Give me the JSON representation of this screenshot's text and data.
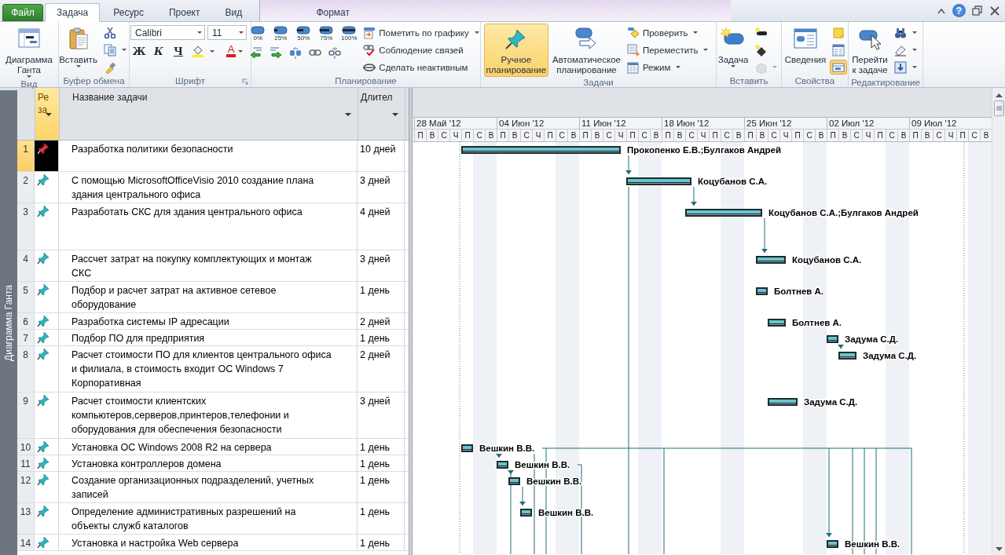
{
  "ribbon": {
    "tabs": [
      {
        "label": "Файл",
        "kind": "file",
        "selected": false
      },
      {
        "label": "Задача",
        "kind": "tab",
        "selected": true
      },
      {
        "label": "Ресурс",
        "kind": "tab",
        "selected": false
      },
      {
        "label": "Проект",
        "kind": "tab",
        "selected": false
      },
      {
        "label": "Вид",
        "kind": "tab",
        "selected": false
      },
      {
        "label": "Формат",
        "kind": "contextual",
        "selected": false
      }
    ],
    "help": "?",
    "groups": [
      {
        "label": "Вид",
        "items": [
          {
            "kind": "large",
            "label_lines": [
              "Диаграмма",
              "Ганта"
            ],
            "dropdown": true
          }
        ]
      },
      {
        "label": "Буфер обмена",
        "items": [
          {
            "kind": "large",
            "label_lines": [
              "Вставить"
            ],
            "dropdown": true
          },
          {
            "kind": "column",
            "items": [
              {
                "kind": "small",
                "dropdown": false
              },
              {
                "kind": "small",
                "dropdown": true
              },
              {
                "kind": "small",
                "dropdown": false
              }
            ]
          }
        ]
      },
      {
        "label": "Шрифт",
        "launcher": true,
        "items": [
          {
            "kind": "column",
            "items": [
              {
                "kind": "row",
                "items": [
                  {
                    "kind": "field",
                    "value": "Calibri"
                  },
                  {
                    "kind": "field",
                    "value": "11"
                  }
                ]
              },
              {
                "kind": "row",
                "items": [
                  {
                    "kind": "bold",
                    "label": "Ж"
                  },
                  {
                    "kind": "italic",
                    "label": "К"
                  },
                  {
                    "kind": "underline",
                    "label": "Ч"
                  },
                  {
                    "kind": "small",
                    "dropdown": true
                  },
                  {
                    "kind": "font-color",
                    "label": "А",
                    "color": "#d42020"
                  }
                ]
              }
            ]
          }
        ]
      },
      {
        "label": "Планирование",
        "items": [
          {
            "kind": "column",
            "items": [
              {
                "kind": "row",
                "items": [
                  {
                    "kind": "percent",
                    "label": "0%"
                  },
                  {
                    "kind": "percent",
                    "label": "25%"
                  },
                  {
                    "kind": "percent",
                    "label": "50%"
                  },
                  {
                    "kind": "percent",
                    "label": "75%"
                  },
                  {
                    "kind": "percent",
                    "label": "100%"
                  }
                ]
              },
              {
                "kind": "row",
                "items": [
                  {
                    "kind": "small",
                    "dropdown": false
                  },
                  {
                    "kind": "small",
                    "dropdown": false
                  },
                  {
                    "kind": "small",
                    "dropdown": false
                  },
                  {
                    "kind": "small",
                    "dropdown": false
                  },
                  {
                    "kind": "small",
                    "dropdown": false
                  }
                ]
              }
            ]
          },
          {
            "kind": "column",
            "items": [
              {
                "kind": "small",
                "label": "Пометить по графику",
                "dropdown": true
              },
              {
                "kind": "small",
                "label": "Соблюдение связей",
                "dropdown": false
              },
              {
                "kind": "small",
                "label": "Сделать неактивным",
                "dropdown": false
              }
            ]
          }
        ]
      },
      {
        "label": "Задачи",
        "items": [
          {
            "kind": "large",
            "label_lines": [
              "Ручное",
              "планирование"
            ],
            "dropdown": false,
            "selected": true
          },
          {
            "kind": "large",
            "label_lines": [
              "Автоматическое",
              "планирование"
            ],
            "dropdown": false,
            "selected": false
          },
          {
            "kind": "column",
            "items": [
              {
                "kind": "small",
                "label": "Проверить",
                "dropdown": true
              },
              {
                "kind": "small",
                "label": "Переместить",
                "dropdown": true
              },
              {
                "kind": "small",
                "label": "Режим",
                "dropdown": true
              }
            ]
          }
        ]
      },
      {
        "label": "Вставить",
        "items": [
          {
            "kind": "large",
            "label_lines": [
              "Задача"
            ],
            "dropdown": true
          },
          {
            "kind": "column",
            "items": [
              {
                "kind": "small",
                "dropdown": false,
                "disabled": false
              },
              {
                "kind": "small",
                "dropdown": false,
                "disabled": false
              },
              {
                "kind": "small",
                "dropdown": true,
                "disabled": true
              }
            ]
          }
        ]
      },
      {
        "label": "Свойства",
        "items": [
          {
            "kind": "large",
            "label_lines": [
              "Сведения"
            ],
            "dropdown": false
          },
          {
            "kind": "column",
            "items": [
              {
                "kind": "small",
                "dropdown": false,
                "on": false
              },
              {
                "kind": "small",
                "dropdown": false,
                "on": false
              },
              {
                "kind": "small",
                "dropdown": false,
                "on": true
              }
            ]
          }
        ]
      },
      {
        "label": "Редактирование",
        "items": [
          {
            "kind": "large",
            "label_lines": [
              "Перейти",
              "к задаче"
            ],
            "dropdown": false
          },
          {
            "kind": "column",
            "items": [
              {
                "kind": "small",
                "dropdown": true
              },
              {
                "kind": "small",
                "dropdown": true
              },
              {
                "kind": "small",
                "dropdown": true
              }
            ]
          }
        ]
      }
    ]
  },
  "view_bar": {
    "label": "Диаграмма Ганта"
  },
  "table": {
    "columns": [
      {
        "kind": "indicator",
        "label_lines": [
          "Ре",
          "за"
        ],
        "selected": true
      },
      {
        "kind": "name",
        "label_lines": [
          "Название задачи"
        ],
        "selected": false
      },
      {
        "kind": "duration",
        "label_lines": [
          "Длител"
        ],
        "selected": false
      }
    ],
    "rows": [
      {
        "id": "1",
        "selected": true,
        "name_lines": [
          "Разработка политики безопасности"
        ],
        "duration": "10 дней",
        "resources": "Прокопенко Е.В.;Булгаков Андрей"
      },
      {
        "id": "2",
        "selected": false,
        "name_lines": [
          "С помощью MicrosoftOfficeVisio 2010 создание плана",
          "здания центрального офиса"
        ],
        "duration": "3 дней",
        "resources": "Коцубанов С.А."
      },
      {
        "id": "3",
        "selected": false,
        "name_lines": [
          "Разработать СКС для здания центрального офиса"
        ],
        "duration": "4 дней",
        "resources": "Коцубанов С.А.;Булгаков Андрей"
      },
      {
        "id": "4",
        "selected": false,
        "name_lines": [
          "Рассчет затрат на покупку комплектующих и монтаж",
          "СКС"
        ],
        "duration": "3 дней",
        "resources": "Коцубанов С.А."
      },
      {
        "id": "5",
        "selected": false,
        "name_lines": [
          "Подбор и расчет затрат на активное сетевое",
          "оборудование"
        ],
        "duration": "1 день",
        "resources": "Болтнев А."
      },
      {
        "id": "6",
        "selected": false,
        "name_lines": [
          "Разработка системы IP адресации"
        ],
        "duration": "2 дней",
        "resources": "Болтнев А."
      },
      {
        "id": "7",
        "selected": false,
        "name_lines": [
          "Подбор ПО для предприятия"
        ],
        "duration": "1 день",
        "resources": "Задума С.Д."
      },
      {
        "id": "8",
        "selected": false,
        "name_lines": [
          "Расчет стоимости ПО для клиентов центрального офиса",
          "и филиала, в стоимость входит ОС Windows 7",
          "Корпоративная"
        ],
        "duration": "2 дней",
        "resources": "Задума С.Д."
      },
      {
        "id": "9",
        "selected": false,
        "name_lines": [
          "Расчет стоимости клиентских",
          "компьютеров,серверов,принтеров,телефонии и",
          "оборудования для обеспечения безопасности"
        ],
        "duration": "3 дней",
        "resources": "Задума С.Д."
      },
      {
        "id": "10",
        "selected": false,
        "name_lines": [
          "Установка ОС Windows 2008 R2 на сервера"
        ],
        "duration": "1 день",
        "resources": "Вешкин В.В."
      },
      {
        "id": "11",
        "selected": false,
        "name_lines": [
          "Установка контроллеров домена"
        ],
        "duration": "1 день",
        "resources": "Вешкин В.В."
      },
      {
        "id": "12",
        "selected": false,
        "name_lines": [
          "Создание организационных подразделений, учетных",
          "записей"
        ],
        "duration": "1 день",
        "resources": "Вешкин В.В."
      },
      {
        "id": "13",
        "selected": false,
        "name_lines": [
          "Определение административных разрешений на",
          "объекты служб каталогов"
        ],
        "duration": "1 день",
        "resources": "Вешкин В.В."
      },
      {
        "id": "14",
        "selected": false,
        "name_lines": [
          "Установка и настройка Web сервера"
        ],
        "duration": "1 день",
        "resources": "Вешкин В.В."
      }
    ]
  },
  "gantt": {
    "weeks": [
      {
        "label": "28 Май '12",
        "days": [
          "П",
          "В",
          "С",
          "Ч",
          "П",
          "С",
          "В"
        ]
      },
      {
        "label": "04 Июн '12",
        "days": [
          "П",
          "В",
          "С",
          "Ч",
          "П",
          "С",
          "В"
        ]
      },
      {
        "label": "11 Июн '12",
        "days": [
          "П",
          "В",
          "С",
          "Ч",
          "П",
          "С",
          "В"
        ]
      },
      {
        "label": "18 Июн '12",
        "days": [
          "П",
          "В",
          "С",
          "Ч",
          "П",
          "С",
          "В"
        ]
      },
      {
        "label": "25 Июн '12",
        "days": [
          "П",
          "В",
          "С",
          "Ч",
          "П",
          "С",
          "В"
        ]
      },
      {
        "label": "02 Июл '12",
        "days": [
          "П",
          "В",
          "С",
          "Ч",
          "П",
          "С",
          "В"
        ]
      },
      {
        "label": "09 Июл '12",
        "days": [
          "П",
          "В",
          "С",
          "Ч",
          "П",
          "С",
          "В"
        ]
      }
    ]
  }
}
